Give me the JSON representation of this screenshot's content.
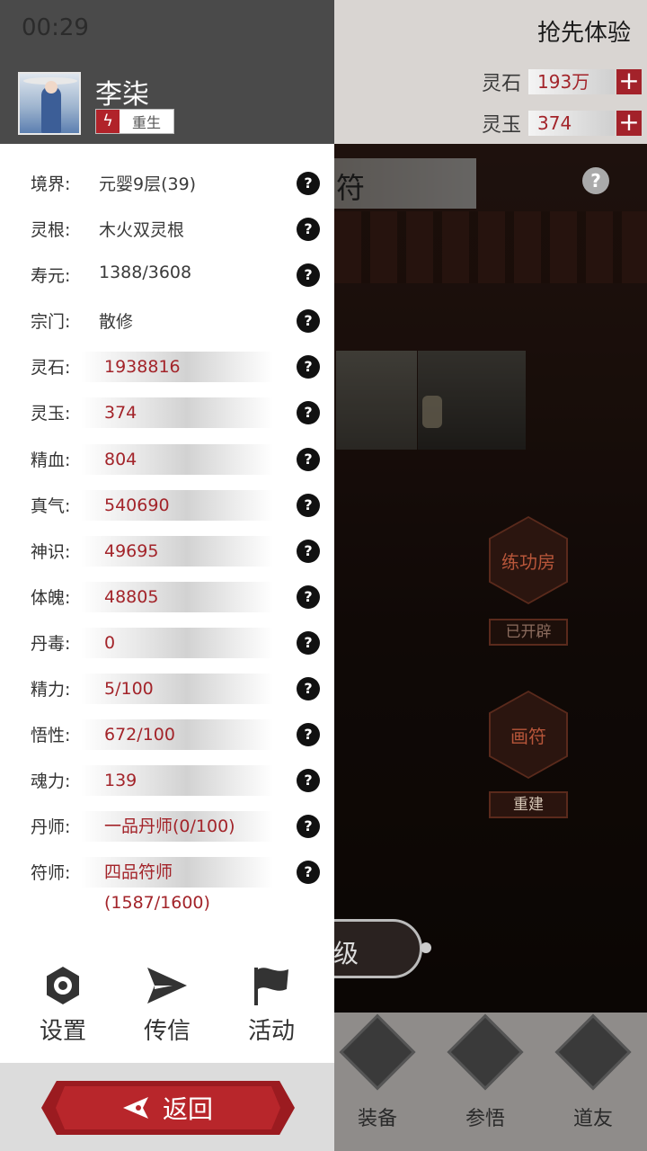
{
  "status_bar": {
    "time": "00:29"
  },
  "header": {
    "trial": "抢先体验",
    "currencies": [
      {
        "label": "灵石",
        "value": "193万"
      },
      {
        "label": "灵玉",
        "value": "374"
      }
    ],
    "plus_glyph": "+"
  },
  "scene": {
    "banner_text": "符",
    "help_glyph": "?",
    "rooms": [
      {
        "name": "练功房",
        "status": "已开辟"
      },
      {
        "name": "画符",
        "status": "重建"
      }
    ],
    "pill_text": "级",
    "bottom_nav": [
      "装备",
      "参悟",
      "道友"
    ]
  },
  "character": {
    "name": "李柒",
    "rebirth_label": "重生",
    "rebirth_icon": "lightning-icon"
  },
  "stats": [
    {
      "label": "境界:",
      "value": "元婴9层(39)",
      "boxed": false
    },
    {
      "label": "灵根:",
      "value": "木火双灵根",
      "boxed": false
    },
    {
      "label": "寿元:",
      "value": "1388/3608",
      "boxed": false
    },
    {
      "label": "宗门:",
      "value": "散修",
      "boxed": false
    },
    {
      "label": "灵石:",
      "value": "1938816",
      "boxed": true
    },
    {
      "label": "灵玉:",
      "value": "374",
      "boxed": true
    },
    {
      "label": "精血:",
      "value": "804",
      "boxed": true
    },
    {
      "label": "真气:",
      "value": "540690",
      "boxed": true
    },
    {
      "label": "神识:",
      "value": "49695",
      "boxed": true
    },
    {
      "label": "体魄:",
      "value": "48805",
      "boxed": true
    },
    {
      "label": "丹毒:",
      "value": "0",
      "boxed": true
    },
    {
      "label": "精力:",
      "value": "5/100",
      "boxed": true
    },
    {
      "label": "悟性:",
      "value": "672/100",
      "boxed": true
    },
    {
      "label": "魂力:",
      "value": "139",
      "boxed": true
    },
    {
      "label": "丹师:",
      "value": "一品丹师(0/100)",
      "boxed": true
    },
    {
      "label": "符师:",
      "value": "四品符师(1587/1600)",
      "boxed": true
    }
  ],
  "stat_help_glyph": "?",
  "actions": [
    {
      "label": "设置",
      "icon": "gear-icon"
    },
    {
      "label": "传信",
      "icon": "send-icon"
    },
    {
      "label": "活动",
      "icon": "flag-icon"
    }
  ],
  "return_button": {
    "label": "返回",
    "icon": "back-arrow-icon"
  },
  "colors": {
    "accent_red": "#a3242a",
    "panel_header": "#4a4a4a"
  }
}
